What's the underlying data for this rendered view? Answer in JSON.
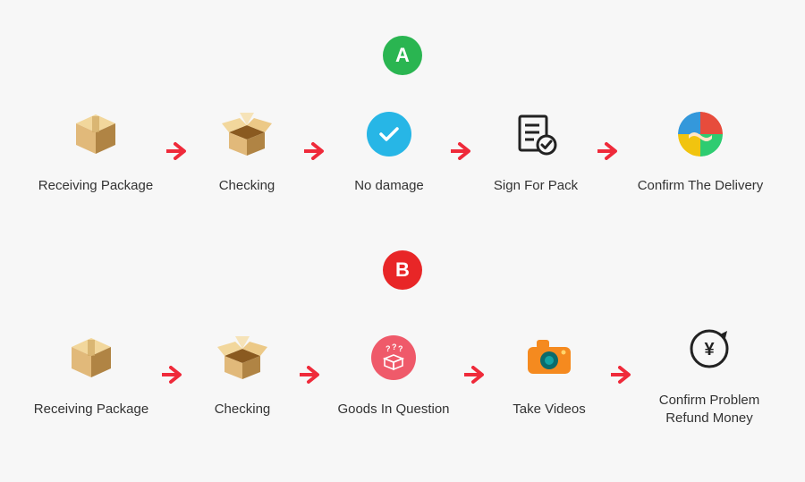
{
  "colors": {
    "arrow": "#ef2a3a",
    "green": "#2ab551",
    "red": "#e82627",
    "blue": "#27b6e6",
    "pink": "#ef5a6a",
    "orange": "#f58a1f",
    "box_face": "#e1b97a",
    "box_dark": "#b08444",
    "box_top": "#f2d79c"
  },
  "flowA": {
    "badge": "A",
    "steps": [
      {
        "icon": "closed-box",
        "label": "Receiving Package"
      },
      {
        "icon": "open-box",
        "label": "Checking"
      },
      {
        "icon": "blue-check",
        "label": "No damage"
      },
      {
        "icon": "document-check",
        "label": "Sign For Pack"
      },
      {
        "icon": "handshake",
        "label": "Confirm The Delivery"
      }
    ]
  },
  "flowB": {
    "badge": "B",
    "steps": [
      {
        "icon": "closed-box",
        "label": "Receiving Package"
      },
      {
        "icon": "open-box",
        "label": "Checking"
      },
      {
        "icon": "pink-question-box",
        "label": "Goods In Question"
      },
      {
        "icon": "camera",
        "label": "Take Videos"
      },
      {
        "icon": "refund",
        "label": "Confirm Problem\nRefund Money"
      }
    ]
  }
}
